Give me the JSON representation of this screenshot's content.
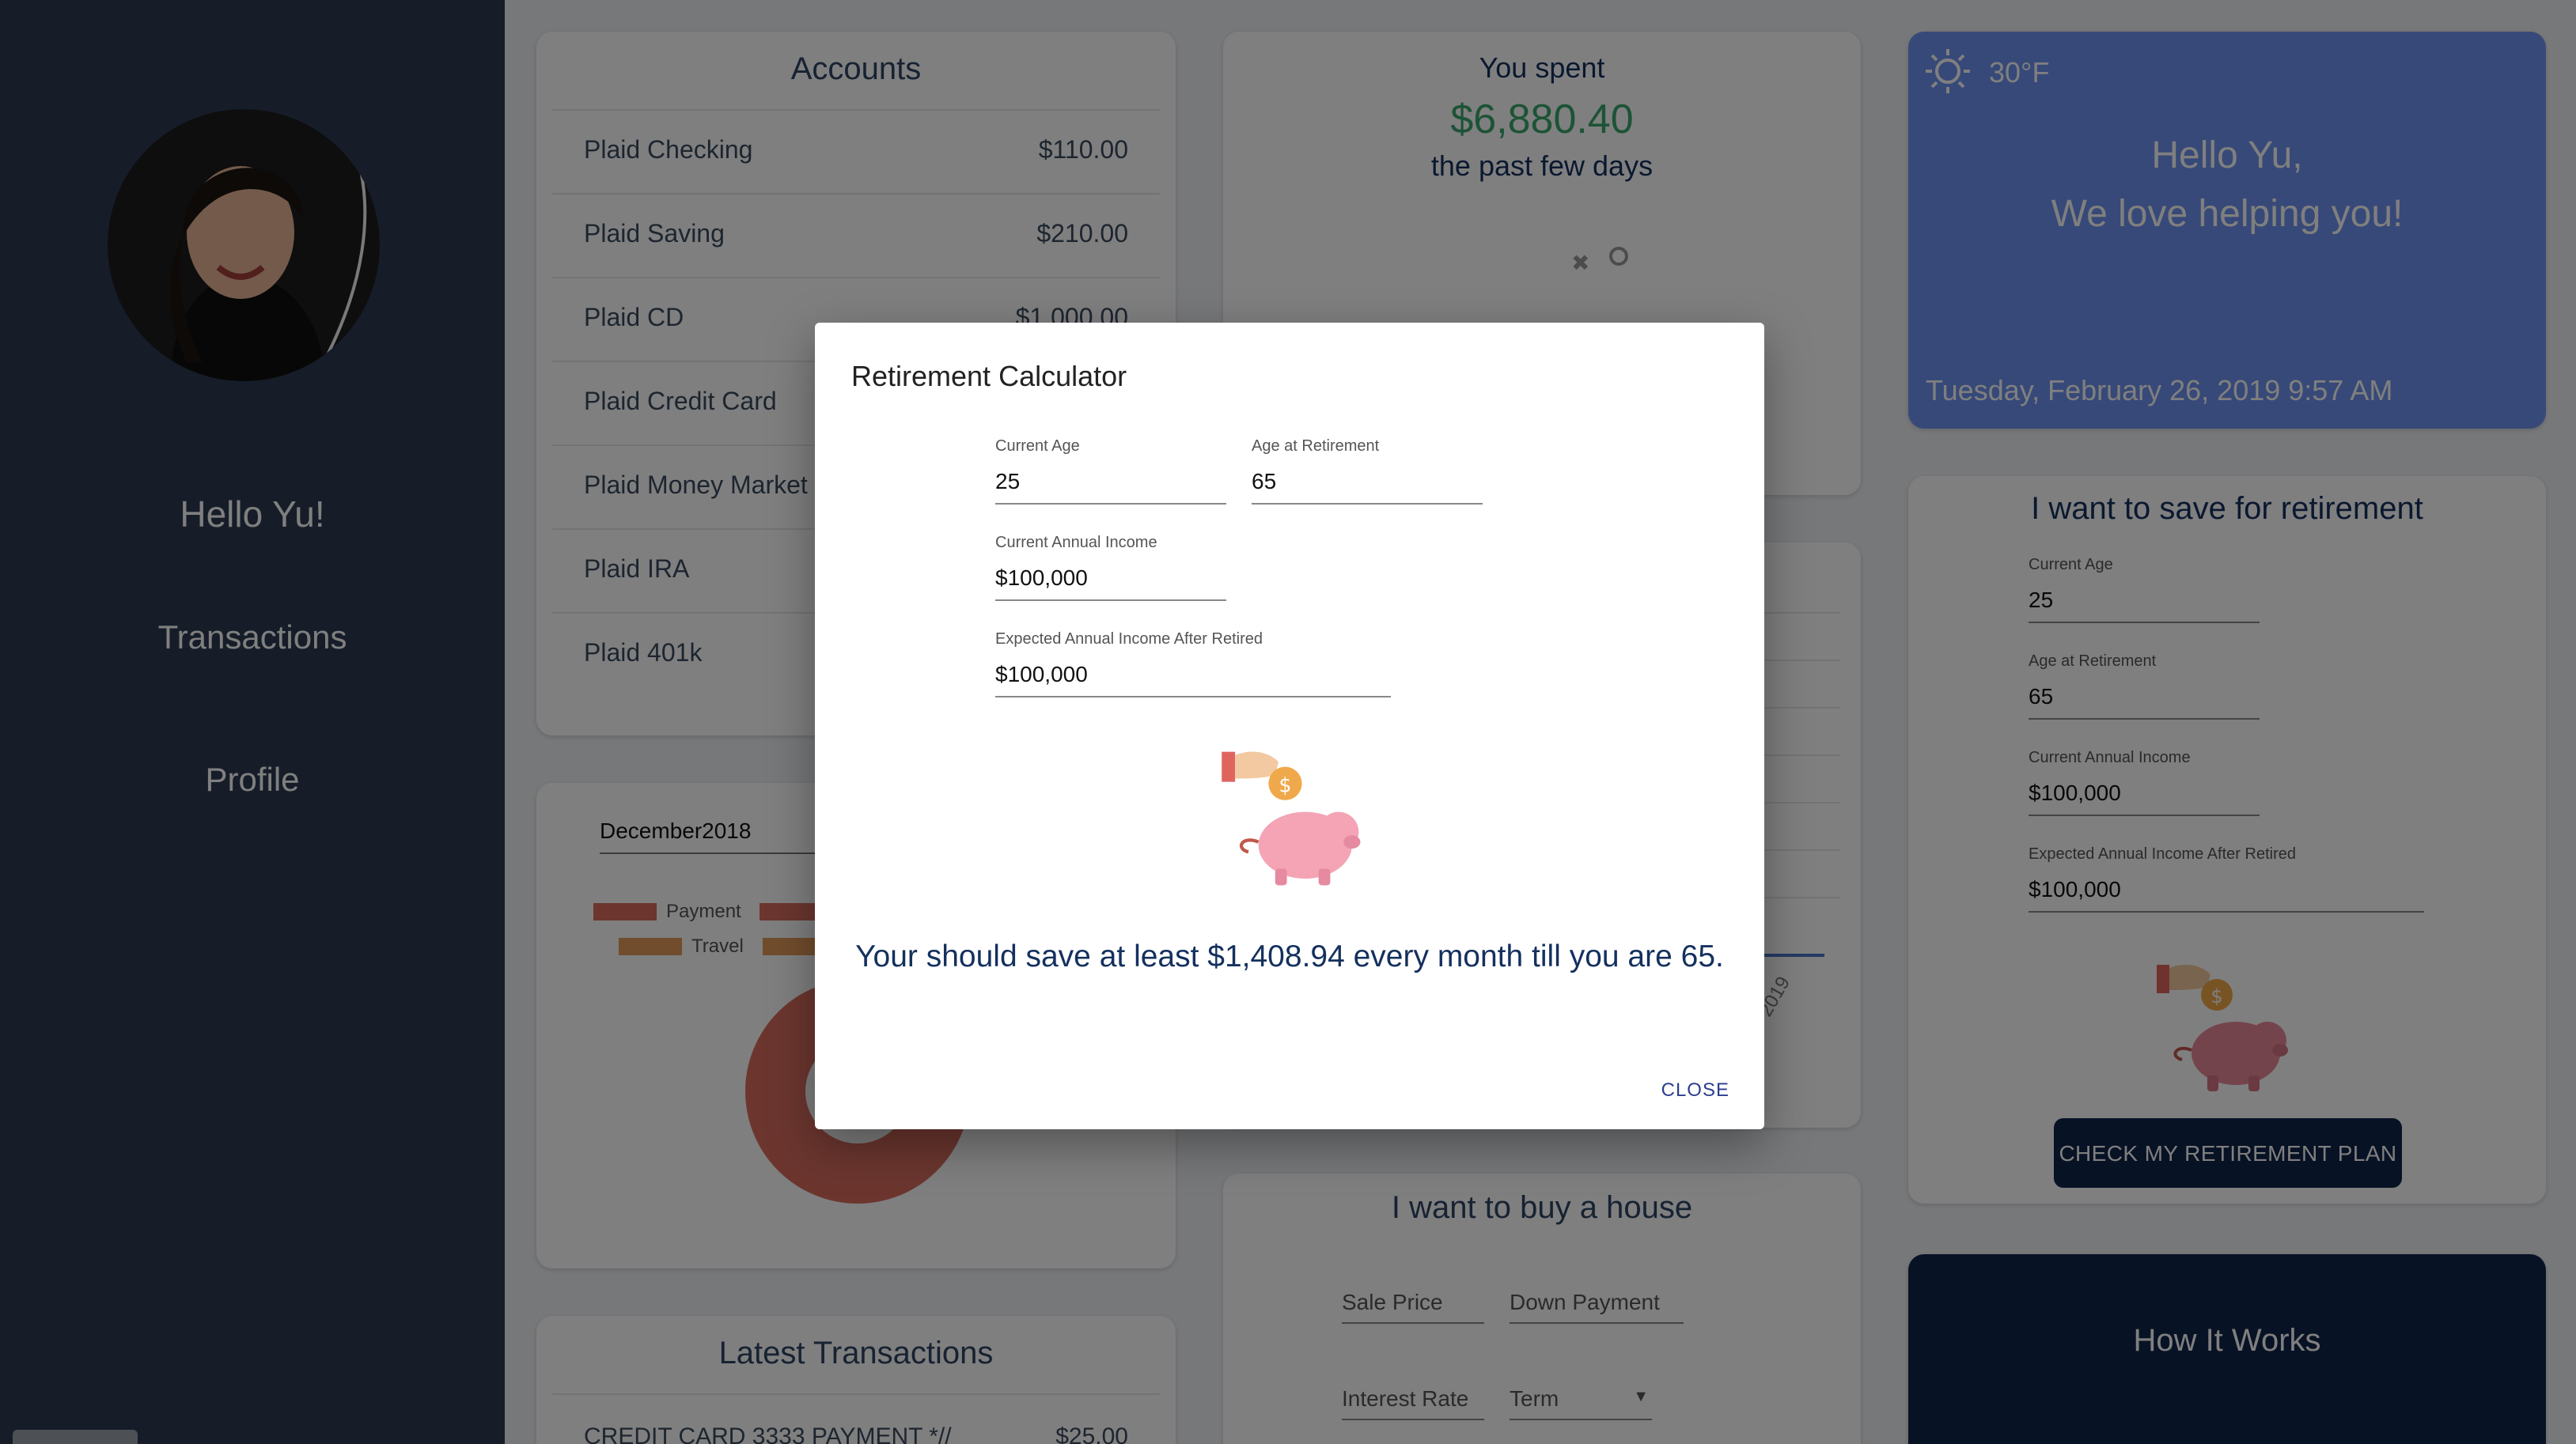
{
  "sidebar": {
    "greeting": "Hello Yu!",
    "nav": [
      "Transactions",
      "Profile"
    ]
  },
  "accounts": {
    "title": "Accounts",
    "items": [
      {
        "name": "Plaid Checking",
        "amount": "$110.00"
      },
      {
        "name": "Plaid Saving",
        "amount": "$210.00"
      },
      {
        "name": "Plaid CD",
        "amount": "$1,000.00"
      },
      {
        "name": "Plaid Credit Card",
        "amount": ""
      },
      {
        "name": "Plaid Money Market",
        "amount": ""
      },
      {
        "name": "Plaid IRA",
        "amount": ""
      },
      {
        "name": "Plaid 401k",
        "amount": ""
      }
    ]
  },
  "spending": {
    "line1": "You spent",
    "amount": "$6,880.40",
    "line2": "the past few days"
  },
  "category_chart": {
    "month": "December2018",
    "legend": [
      "Payment",
      "Travel"
    ],
    "colors": [
      "#d86c5f",
      "#e29a5a"
    ]
  },
  "xaxis_partial": "2019",
  "transactions": {
    "title": "Latest Transactions",
    "first_row": {
      "desc": "CREDIT CARD 3333 PAYMENT *//",
      "amount": "$25.00"
    }
  },
  "house": {
    "title": "I want to buy a house",
    "sale_price": "Sale Price",
    "down_payment": "Down Payment",
    "interest_rate": "Interest Rate",
    "term": "Term"
  },
  "weather": {
    "temp": "30°F",
    "greeting1": "Hello Yu,",
    "greeting2": "We love helping you!",
    "datetime": "Tuesday, February 26, 2019 9:57 AM"
  },
  "retire_card": {
    "title": "I want to save for retirement",
    "fields": [
      {
        "label": "Current Age",
        "value": "25"
      },
      {
        "label": "Age at Retirement",
        "value": "65"
      },
      {
        "label": "Current Annual Income",
        "value": "$100,000"
      },
      {
        "label": "Expected Annual Income After Retired",
        "value": "$100,000"
      }
    ],
    "button": "CHECK MY RETIREMENT PLAN"
  },
  "how_it_works": "How It Works",
  "modal": {
    "title": "Retirement Calculator",
    "current_age": {
      "label": "Current Age",
      "value": "25"
    },
    "retire_age": {
      "label": "Age at Retirement",
      "value": "65"
    },
    "income": {
      "label": "Current Annual Income",
      "value": "$100,000"
    },
    "expected": {
      "label": "Expected Annual Income After Retired",
      "value": "$100,000"
    },
    "result": "Your should save at least $1,408.94 every month till you are 65.",
    "close": "CLOSE"
  }
}
